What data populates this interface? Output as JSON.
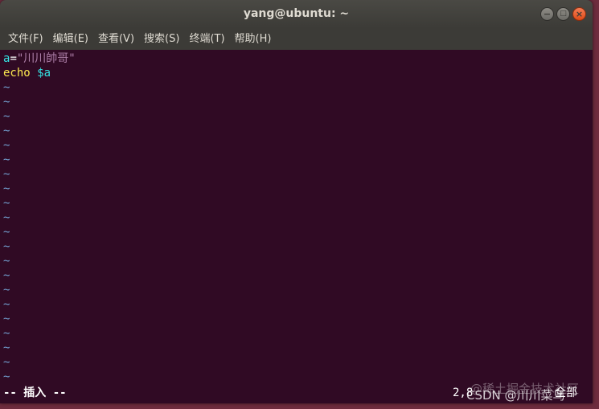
{
  "window": {
    "title": "yang@ubuntu: ~",
    "controls": {
      "minimize": "−",
      "maximize": "□",
      "close": "×"
    }
  },
  "menu": [
    {
      "label": "文件(F)"
    },
    {
      "label": "编辑(E)"
    },
    {
      "label": "查看(V)"
    },
    {
      "label": "搜索(S)"
    },
    {
      "label": "终端(T)"
    },
    {
      "label": "帮助(H)"
    }
  ],
  "editor": {
    "line1": {
      "var": "a",
      "op": "=",
      "string": "\"川川帥哥\""
    },
    "line2": {
      "cmd": "echo",
      "space": " ",
      "arg": "$a"
    },
    "tilde": "~",
    "mode": "-- 插入 --",
    "cursor_pos": "2,8",
    "scroll": "全部"
  },
  "watermarks": {
    "top": "@稀土掘金技术社区",
    "bottom": "CSDN @川川菜鸟"
  },
  "colors": {
    "terminal_bg": "#300a24",
    "variable": "#34e2e2",
    "string": "#ad7fa8",
    "command": "#fce94f",
    "tilde": "#729fcf"
  }
}
